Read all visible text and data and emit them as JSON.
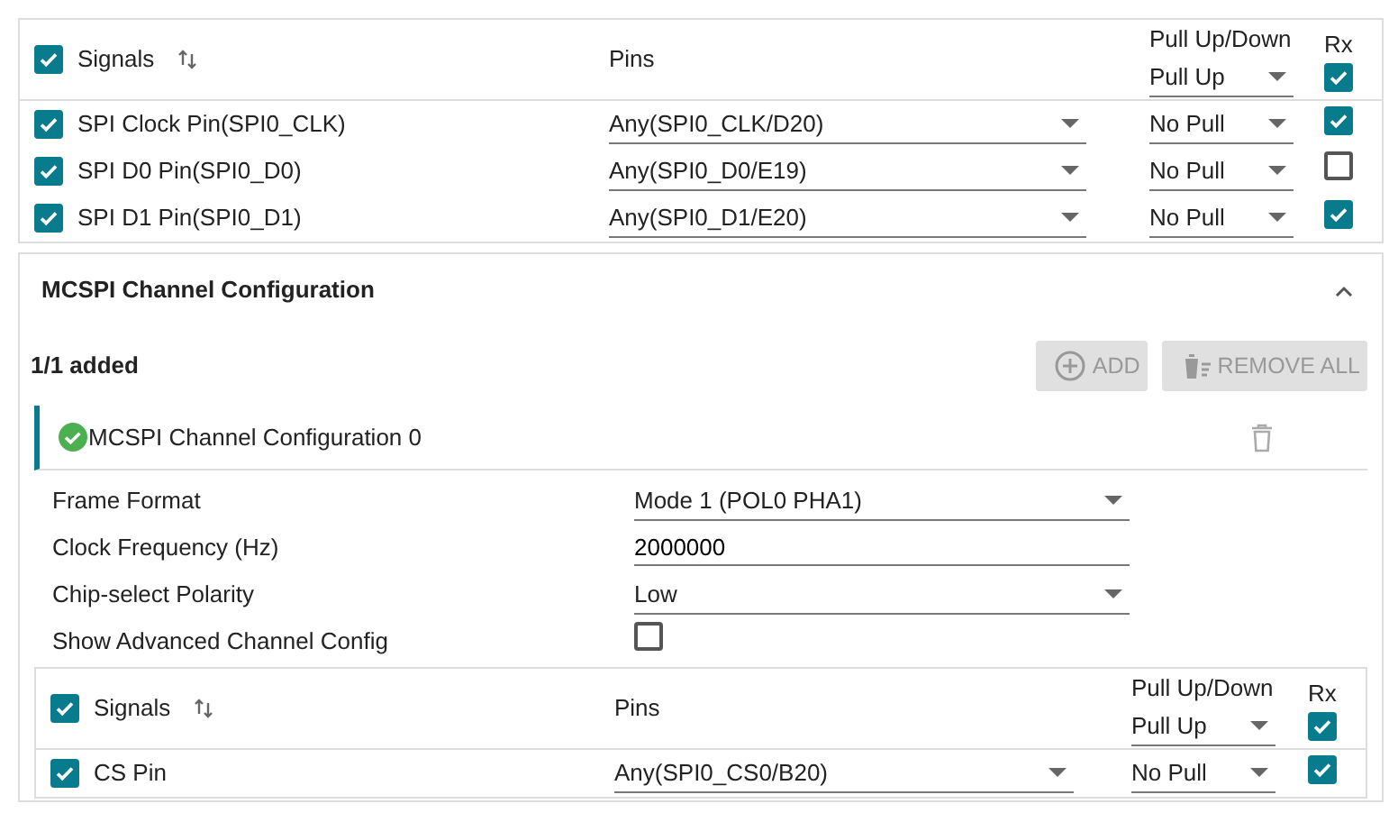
{
  "signals_table": {
    "header": {
      "checked": true,
      "label": "Signals",
      "pins_label": "Pins",
      "pull_label": "Pull Up/Down",
      "pull_value": "Pull Up",
      "rx_label": "Rx",
      "rx_checked": true
    },
    "rows": [
      {
        "checked": true,
        "name": "SPI Clock Pin(SPI0_CLK)",
        "pin": "Any(SPI0_CLK/D20)",
        "pull": "No Pull",
        "rx": true
      },
      {
        "checked": true,
        "name": "SPI D0 Pin(SPI0_D0)",
        "pin": "Any(SPI0_D0/E19)",
        "pull": "No Pull",
        "rx": false
      },
      {
        "checked": true,
        "name": "SPI D1 Pin(SPI0_D1)",
        "pin": "Any(SPI0_D1/E20)",
        "pull": "No Pull",
        "rx": true
      }
    ]
  },
  "channel_section": {
    "title": "MCSPI Channel Configuration",
    "expanded": true,
    "count": "1/1 added",
    "buttons": [
      {
        "kind": "add",
        "label": "ADD",
        "disabled": true
      },
      {
        "kind": "remove",
        "label": "REMOVE ALL",
        "disabled": true
      }
    ],
    "instances": [
      {
        "title": "MCSPI Channel Configuration 0",
        "valid": true,
        "fields": [
          {
            "kind": "select",
            "label": "Frame Format",
            "value": "Mode 1 (POL0 PHA1)"
          },
          {
            "kind": "text",
            "label": "Clock Frequency (Hz)",
            "value": "2000000"
          },
          {
            "kind": "select",
            "label": "Chip-select Polarity",
            "value": "Low"
          },
          {
            "kind": "checkbox",
            "label": "Show Advanced Channel Config",
            "checked": false
          }
        ],
        "signals_table": {
          "header": {
            "checked": true,
            "label": "Signals",
            "pins_label": "Pins",
            "pull_label": "Pull Up/Down",
            "pull_value": "Pull Up",
            "rx_label": "Rx",
            "rx_checked": true
          },
          "rows": [
            {
              "checked": true,
              "name": "CS Pin",
              "pin": "Any(SPI0_CS0/B20)",
              "pull": "No Pull",
              "rx": true
            }
          ]
        }
      }
    ]
  }
}
